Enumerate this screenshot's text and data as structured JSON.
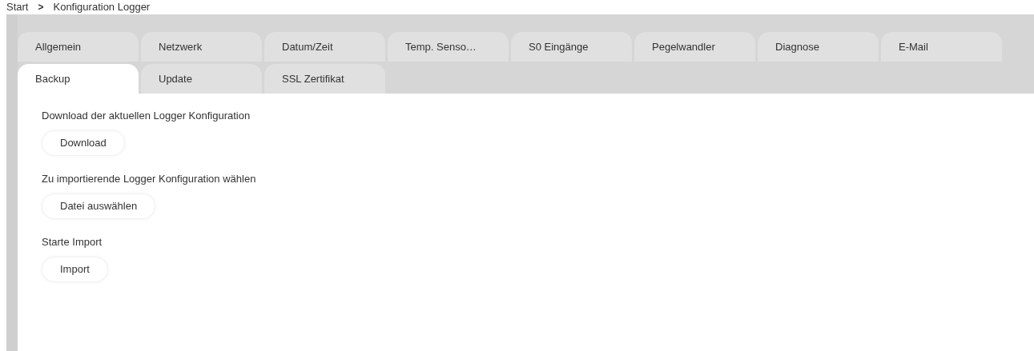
{
  "breadcrumb": [
    {
      "label": "Start"
    },
    {
      "label": ">"
    },
    {
      "label": "Konfiguration Logger"
    }
  ],
  "tab_rows": [
    [
      {
        "label": "Allgemein",
        "selected": false
      },
      {
        "label": "Netzwerk",
        "selected": false
      },
      {
        "label": "Datum/Zeit",
        "selected": false
      },
      {
        "label": "Temp. Senso…",
        "selected": false
      },
      {
        "label": "S0 Eingänge",
        "selected": false
      },
      {
        "label": "Pegelwandler",
        "selected": false
      },
      {
        "label": "Diagnose",
        "selected": false
      },
      {
        "label": "E-Mail",
        "selected": false
      }
    ],
    [
      {
        "label": "Backup",
        "selected": true
      },
      {
        "label": "Update",
        "selected": false
      },
      {
        "label": "SSL Zertifikat",
        "selected": false
      }
    ]
  ],
  "sections": [
    {
      "label": "Download der aktuellen Logger Konfiguration",
      "button": "Download"
    },
    {
      "label": "Zu importierende Logger Konfiguration wählen",
      "button": "Datei auswählen"
    },
    {
      "label": "Starte Import",
      "button": "Import"
    }
  ]
}
